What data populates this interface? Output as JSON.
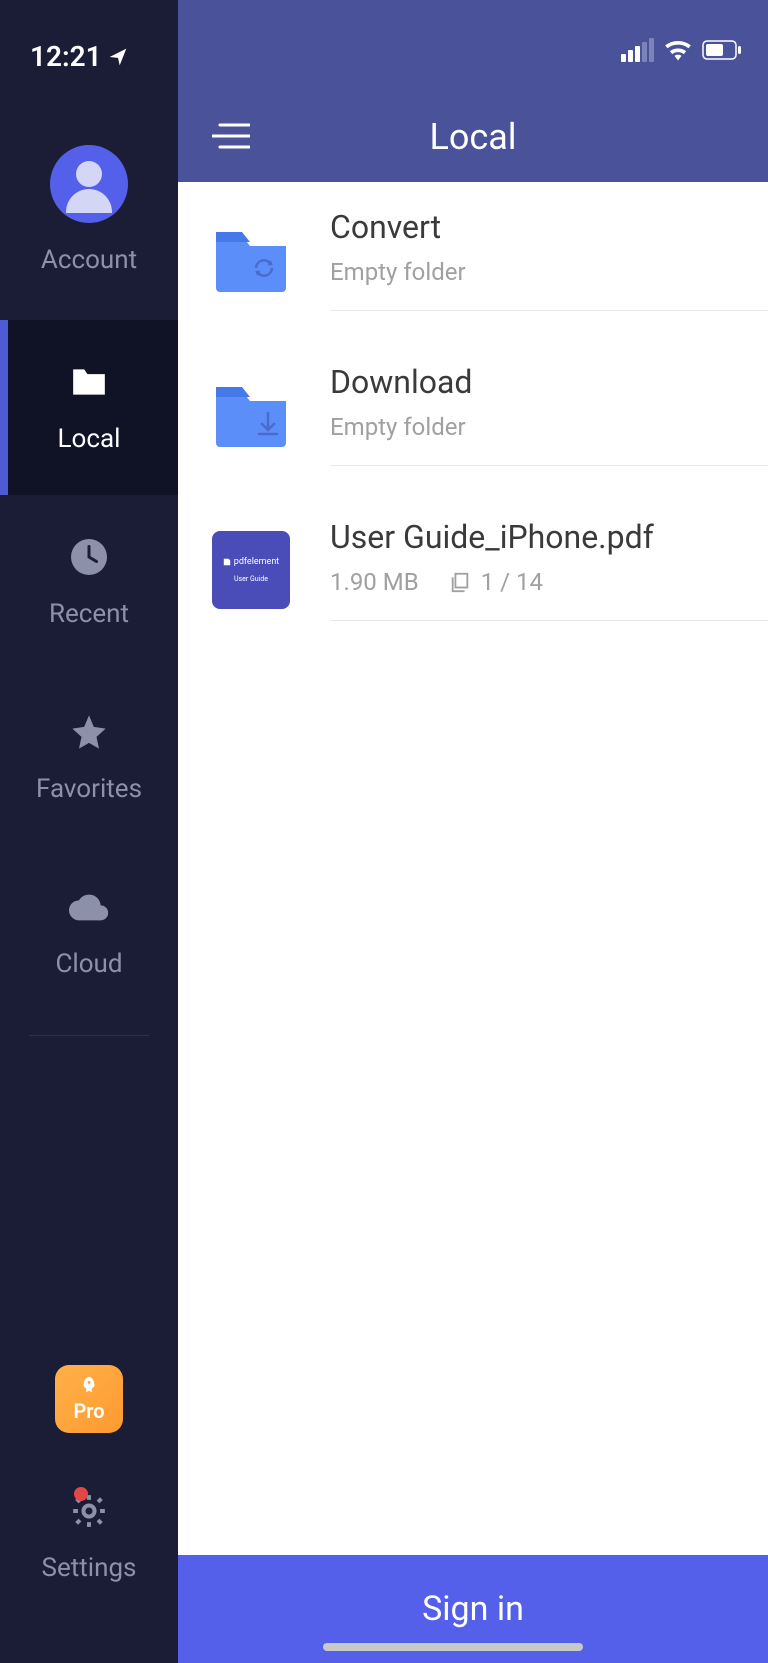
{
  "status": {
    "time": "12:21"
  },
  "sidebar": {
    "account_label": "Account",
    "items": [
      {
        "label": "Local"
      },
      {
        "label": "Recent"
      },
      {
        "label": "Favorites"
      },
      {
        "label": "Cloud"
      }
    ],
    "upgrade_label": "Pro",
    "settings_label": "Settings"
  },
  "header": {
    "title": "Local"
  },
  "files": [
    {
      "name": "Convert",
      "meta": "Empty folder",
      "type": "folder-sync"
    },
    {
      "name": "Download",
      "meta": "Empty folder",
      "type": "folder-download"
    },
    {
      "name": "User Guide_iPhone.pdf",
      "size": "1.90 MB",
      "pages": "1 / 14",
      "type": "pdf",
      "thumb_title": "pdfelement",
      "thumb_sub": "User Guide"
    }
  ],
  "footer": {
    "sign_in": "Sign in"
  }
}
